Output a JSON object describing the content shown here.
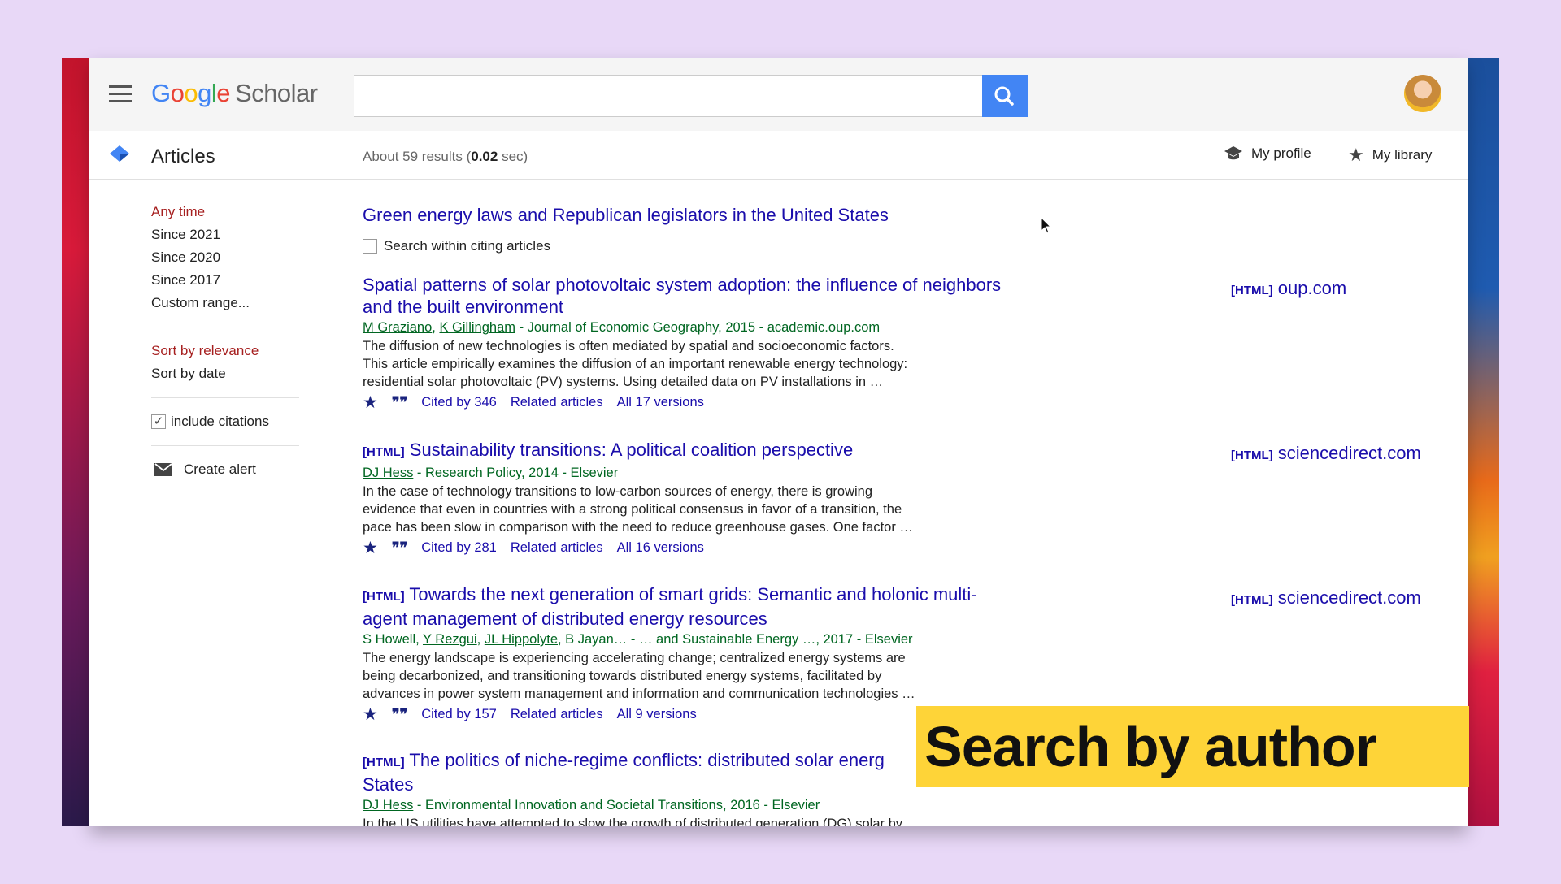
{
  "header": {
    "logo_google": [
      "G",
      "o",
      "o",
      "g",
      "l",
      "e"
    ],
    "logo_scholar": "Scholar",
    "search_value": "",
    "search_placeholder": ""
  },
  "subheader": {
    "section": "Articles",
    "count_prefix": "About 59 results (",
    "count_time": "0.02",
    "count_suffix": " sec)",
    "my_profile": "My profile",
    "my_library": "My library"
  },
  "sidebar": {
    "time_items": [
      "Any time",
      "Since 2021",
      "Since 2020",
      "Since 2017",
      "Custom range..."
    ],
    "sort_items": [
      "Sort by relevance",
      "Sort by date"
    ],
    "include_citations": "include citations",
    "create_alert": "Create alert"
  },
  "main": {
    "query_title": "Green energy laws and Republican legislators in the United States",
    "search_within": "Search within citing articles",
    "results": [
      {
        "tag": "",
        "title_line1": "Spatial patterns of solar photovoltaic system adoption: the influence of neighbors",
        "title_line2": "and the built environment",
        "authors": [
          "M Graziano",
          "K Gillingham"
        ],
        "source": " - Journal of Economic Geography, 2015 - academic.oup.com",
        "snippet": [
          "The diffusion of new technologies is often mediated by spatial and socioeconomic factors.",
          "This article empirically examines the diffusion of an important renewable energy technology:",
          "residential solar photovoltaic (PV) systems. Using detailed data on PV installations in …"
        ],
        "cited": "Cited by 346",
        "related": "Related articles",
        "versions": "All 17 versions",
        "side_tag": "[HTML]",
        "side_domain": "oup.com"
      },
      {
        "tag": "[HTML]",
        "title_line1": "Sustainability transitions: A political coalition perspective",
        "title_line2": "",
        "authors": [
          "DJ Hess"
        ],
        "source": " - Research Policy, 2014 - Elsevier",
        "snippet": [
          "In the case of technology transitions to low-carbon sources of energy, there is growing",
          "evidence that even in countries with a strong political consensus in favor of a transition, the",
          "pace has been slow in comparison with the need to reduce greenhouse gases. One factor …"
        ],
        "cited": "Cited by 281",
        "related": "Related articles",
        "versions": "All 16 versions",
        "side_tag": "[HTML]",
        "side_domain": "sciencedirect.com"
      },
      {
        "tag": "[HTML]",
        "title_line1": "Towards the next generation of smart grids: Semantic and holonic multi-",
        "title_line2": "agent management of distributed energy resources",
        "authors_plain_prefix": "S Howell, ",
        "authors": [
          "Y Rezgui",
          "JL Hippolyte"
        ],
        "authors_plain_suffix": ", B Jayan… - … and Sustainable Energy …, 2017 - Elsevier",
        "snippet": [
          "The energy landscape is experiencing accelerating change; centralized energy systems are",
          "being decarbonized, and transitioning towards distributed energy systems, facilitated by",
          "advances in power system management and information and communication technologies …"
        ],
        "cited": "Cited by 157",
        "related": "Related articles",
        "versions": "All 9 versions",
        "side_tag": "[HTML]",
        "side_domain": "sciencedirect.com"
      },
      {
        "tag": "[HTML]",
        "title_line1": "The politics of niche-regime conflicts: distributed solar energ",
        "title_line2": "States",
        "authors": [
          "DJ Hess"
        ],
        "source": " - Environmental Innovation and Societal Transitions, 2016 - Elsevier",
        "snippet": [
          "In the US utilities have attempted to slow the growth of distributed generation (DG) solar by"
        ]
      }
    ]
  },
  "overlay": {
    "banner": "Search by author"
  },
  "colors": {
    "link": "#1a0dab",
    "meta_green": "#006621",
    "active_red": "#a61f1f",
    "search_blue": "#4285f4",
    "banner_yellow": "#fed438",
    "background_lavender": "#e8d8f7"
  }
}
